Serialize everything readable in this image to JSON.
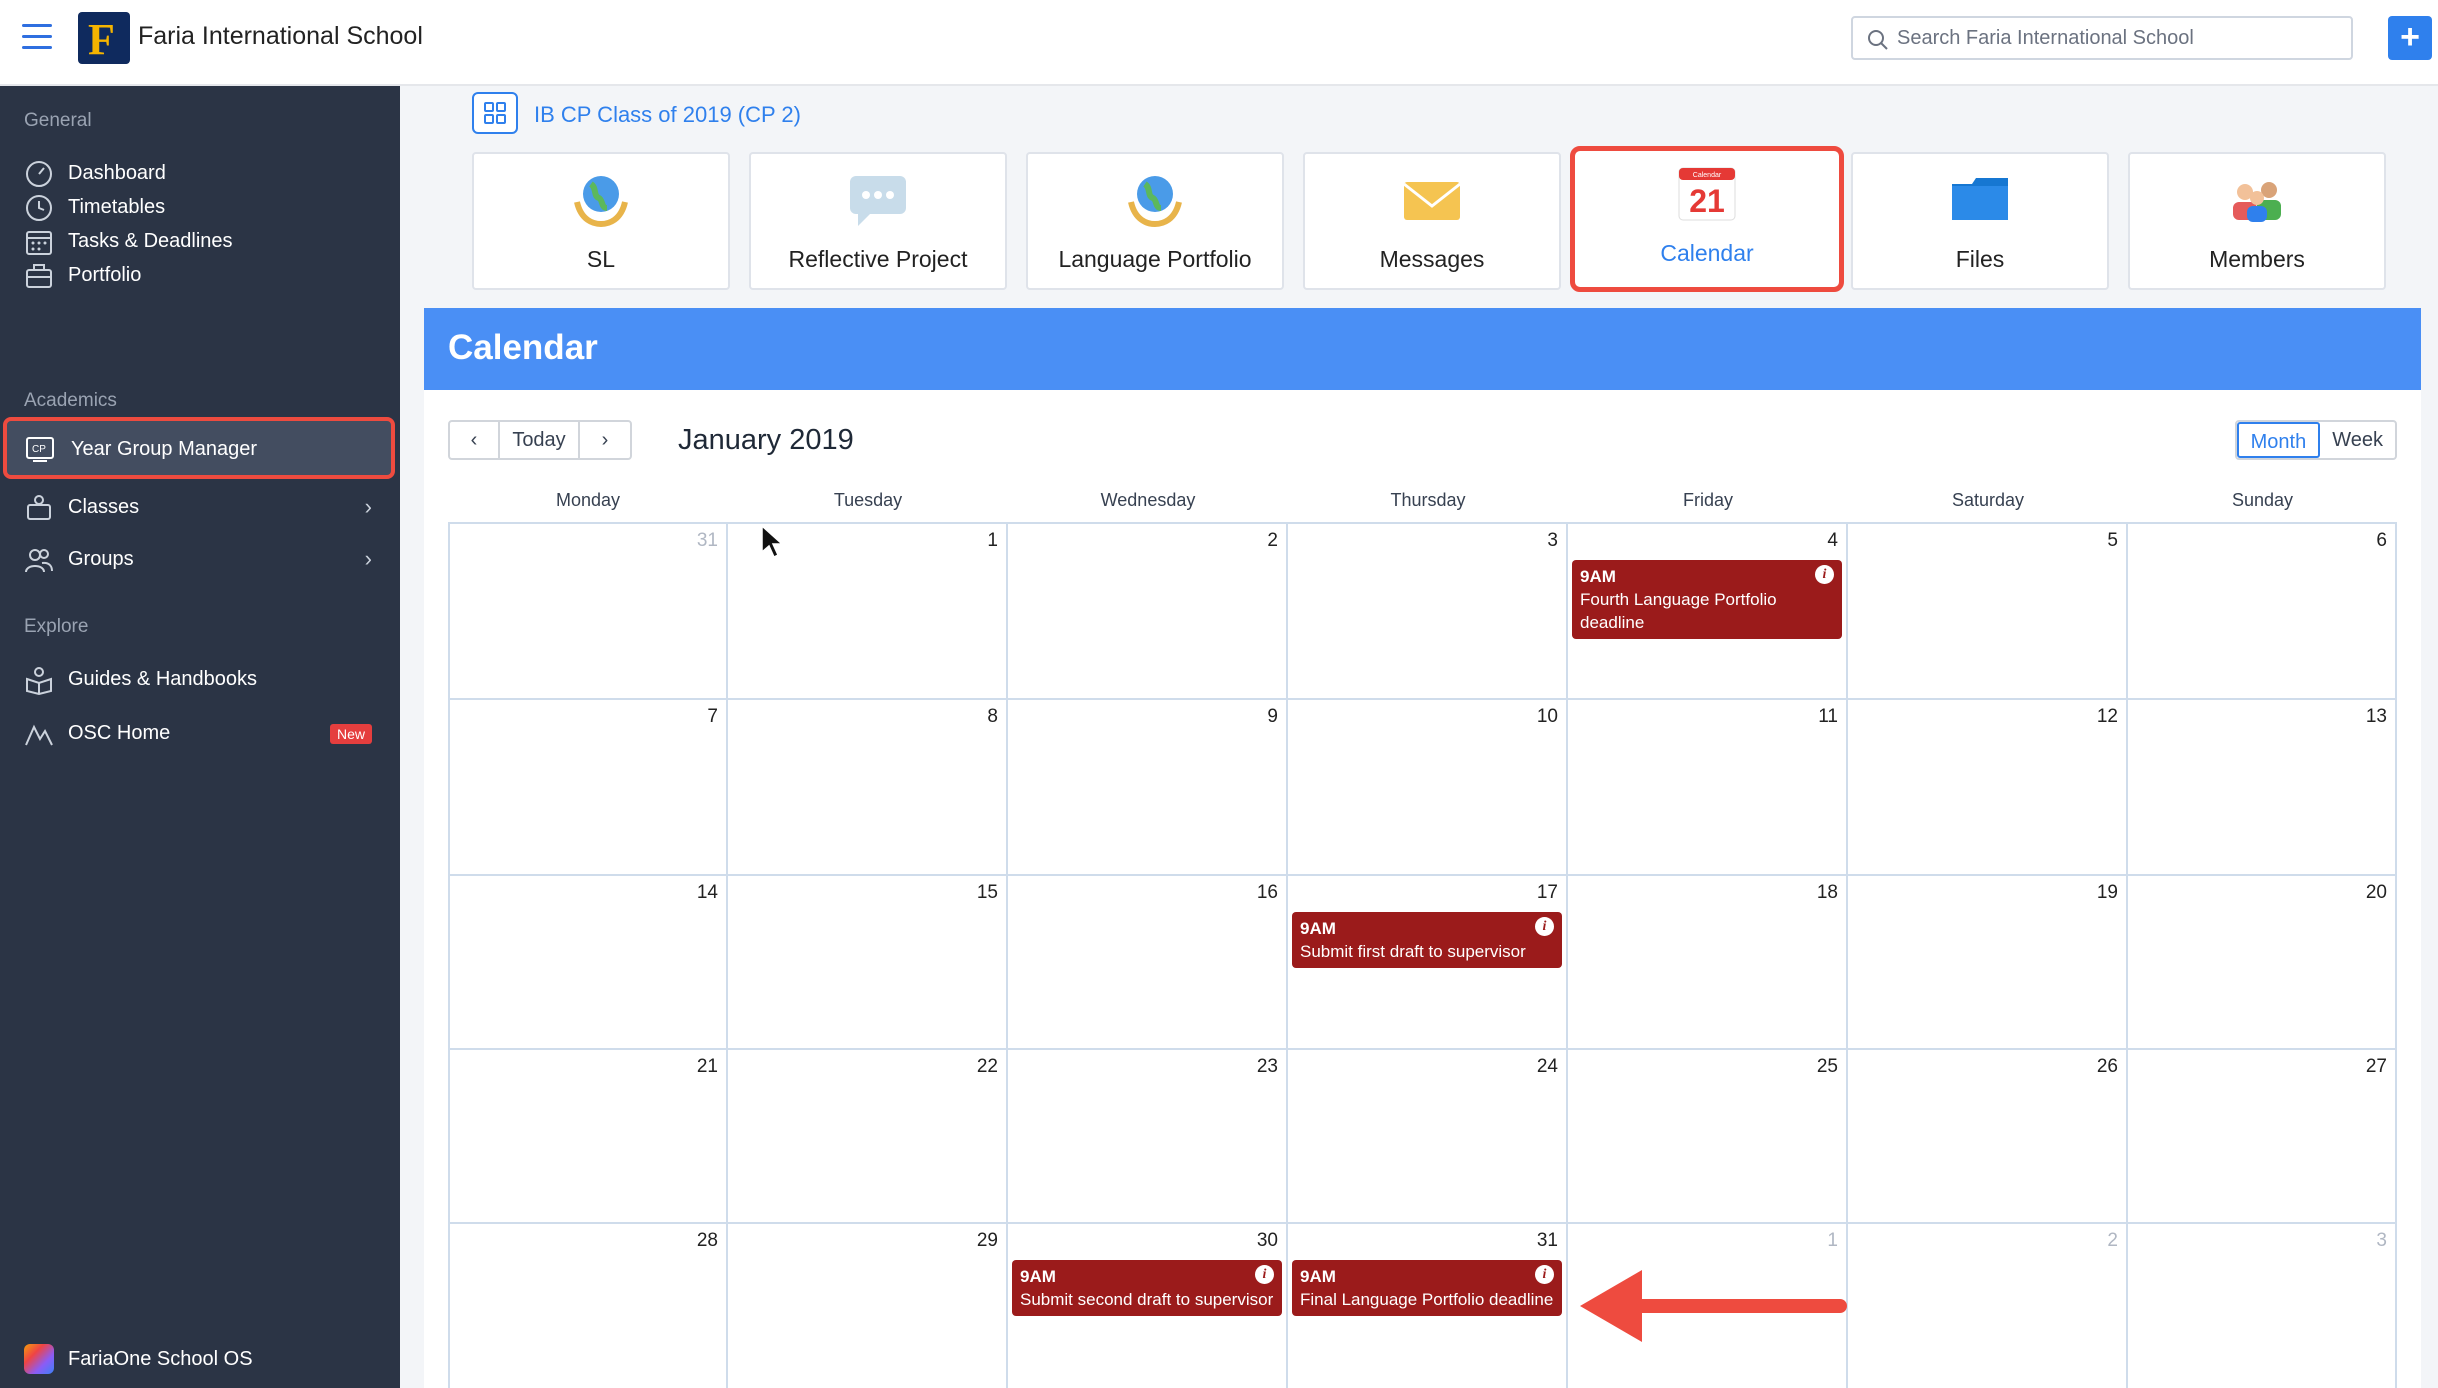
{
  "header": {
    "school_name": "Faria International School",
    "search_placeholder": "Search Faria International School",
    "add_label": "+",
    "logo_letter": "F"
  },
  "sidebar": {
    "sections": {
      "general": "General",
      "academics": "Academics",
      "explore": "Explore"
    },
    "items": [
      {
        "label": "Dashboard",
        "icon": "dashboard-icon"
      },
      {
        "label": "Timetables",
        "icon": "clock-icon"
      },
      {
        "label": "Tasks & Deadlines",
        "icon": "calendar-grid-icon"
      },
      {
        "label": "Portfolio",
        "icon": "briefcase-icon"
      },
      {
        "label": "Year Group Manager",
        "icon": "cp-icon",
        "active": true
      },
      {
        "label": "Classes",
        "icon": "classes-icon"
      },
      {
        "label": "Groups",
        "icon": "groups-icon"
      },
      {
        "label": "Guides & Handbooks",
        "icon": "guides-icon"
      },
      {
        "label": "OSC Home",
        "icon": "osc-icon",
        "badge": "New"
      }
    ],
    "footer": "FariaOne School OS",
    "chevron": "›"
  },
  "class_header": {
    "title": "IB CP Class of 2019 (CP 2)"
  },
  "tiles": [
    {
      "label": "SL",
      "icon": "globe-hands-icon"
    },
    {
      "label": "Reflective Project",
      "icon": "speech-bubble-icon"
    },
    {
      "label": "Language Portfolio",
      "icon": "globe-hands-icon"
    },
    {
      "label": "Messages",
      "icon": "envelope-icon"
    },
    {
      "label": "Calendar",
      "icon": "calendar-21-icon",
      "active": true
    },
    {
      "label": "Files",
      "icon": "folder-icon"
    },
    {
      "label": "Members",
      "icon": "people-icon"
    }
  ],
  "calendar": {
    "banner_title": "Calendar",
    "today_label": "Today",
    "prev": "‹",
    "next": "›",
    "month_title": "January 2019",
    "view_month": "Month",
    "view_week": "Week",
    "calendar_icon_day": "21",
    "calendar_icon_caption": "Calendar",
    "weekdays": [
      "Monday",
      "Tuesday",
      "Wednesday",
      "Thursday",
      "Friday",
      "Saturday",
      "Sunday"
    ],
    "weeks": [
      [
        "31",
        "1",
        "2",
        "3",
        "4",
        "5",
        "6"
      ],
      [
        "7",
        "8",
        "9",
        "10",
        "11",
        "12",
        "13"
      ],
      [
        "14",
        "15",
        "16",
        "17",
        "18",
        "19",
        "20"
      ],
      [
        "21",
        "22",
        "23",
        "24",
        "25",
        "26",
        "27"
      ],
      [
        "28",
        "29",
        "30",
        "31",
        "1",
        "2",
        "3"
      ]
    ],
    "events": [
      {
        "time": "9AM",
        "title": "Fourth Language Portfolio deadline",
        "date": "2019-01-04"
      },
      {
        "time": "9AM",
        "title": "Submit first draft to supervisor",
        "date": "2019-01-17"
      },
      {
        "time": "9AM",
        "title": "Submit second draft to supervisor",
        "date": "2019-01-30"
      },
      {
        "time": "9AM",
        "title": "Final Language Portfolio deadline",
        "date": "2019-01-31"
      }
    ],
    "info_glyph": "i"
  },
  "colors": {
    "accent": "#2f80ed",
    "sidebar_bg": "#2b3445",
    "banner": "#4a8ff5",
    "event_bg": "#9b1b1b",
    "highlight": "#ee4b3f"
  }
}
